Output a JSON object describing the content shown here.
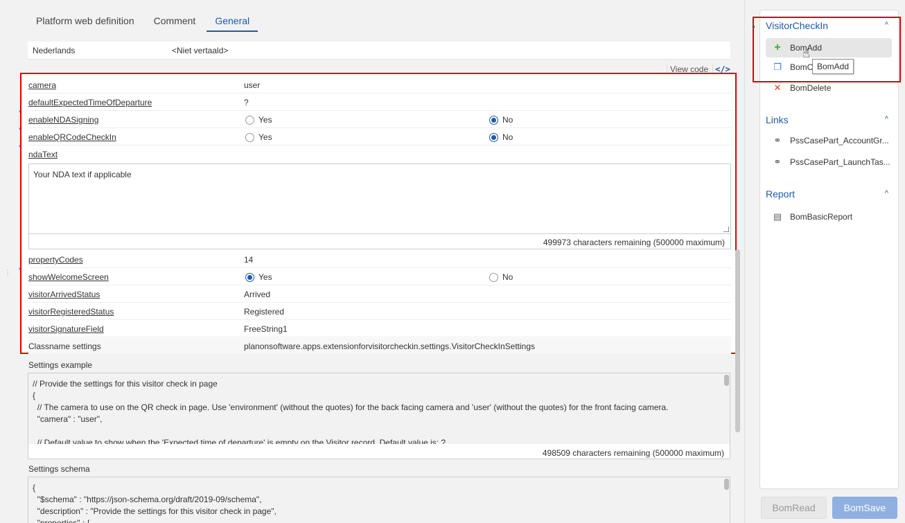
{
  "tabs": [
    {
      "label": "Platform web definition",
      "active": false
    },
    {
      "label": "Comment",
      "active": false
    },
    {
      "label": "General",
      "active": true
    }
  ],
  "language_row": {
    "key": "Nederlands",
    "value": "<Niet vertaald>"
  },
  "view_code": {
    "label": "View code",
    "icon": "code-icon"
  },
  "properties": {
    "camera": {
      "label": "camera",
      "value": "user"
    },
    "defaultExpectedTimeOfDeparture": {
      "label": "defaultExpectedTimeOfDeparture",
      "value": "?"
    },
    "enableNDASigning": {
      "label": "enableNDASigning",
      "yes": "Yes",
      "no": "No",
      "selected": "No"
    },
    "enableQRCodeCheckIn": {
      "label": "enableQRCodeCheckIn",
      "yes": "Yes",
      "no": "No",
      "selected": "No"
    },
    "ndaText": {
      "label": "ndaText",
      "value": "Your NDA text if applicable",
      "remaining": "499973 characters remaining (500000 maximum)"
    },
    "propertyCodes": {
      "label": "propertyCodes",
      "value": "14"
    },
    "showWelcomeScreen": {
      "label": "showWelcomeScreen",
      "yes": "Yes",
      "no": "No",
      "selected": "Yes"
    },
    "visitorArrivedStatus": {
      "label": "visitorArrivedStatus",
      "value": "Arrived"
    },
    "visitorRegisteredStatus": {
      "label": "visitorRegisteredStatus",
      "value": "Registered"
    },
    "visitorSignatureField": {
      "label": "visitorSignatureField",
      "value": "FreeString1"
    },
    "classname": {
      "label": "Classname settings",
      "value": "planonsoftware.apps.extensionforvisitorcheckin.settings.VisitorCheckInSettings"
    }
  },
  "settings_example": {
    "label": "Settings example",
    "code": "// Provide the settings for this visitor check in page\n{\n  // The camera to use on the QR check in page. Use 'environment' (without the quotes) for the back facing camera and 'user' (without the quotes) for the front facing camera.\n  \"camera\" : \"user\",\n\n  // Default value to show when the 'Expected time of departure' is empty on the Visitor record. Default value is: ?",
    "remaining": "498509 characters remaining (500000 maximum)"
  },
  "settings_schema": {
    "label": "Settings schema",
    "code": "{\n  \"$schema\" : \"https://json-schema.org/draft/2019-09/schema\",\n  \"description\" : \"Provide the settings for this visitor check in page\",\n  \"properties\" : {"
  },
  "side": {
    "section1": {
      "title": "VisitorCheckIn",
      "items": [
        {
          "label": "BomAdd",
          "icon": "plus-icon"
        },
        {
          "label": "BomC",
          "icon": "copy-icon"
        },
        {
          "label": "BomDelete",
          "icon": "close-icon"
        }
      ]
    },
    "tooltip": "BomAdd",
    "section2": {
      "title": "Links",
      "items": [
        {
          "label": "PssCasePart_AccountGr...",
          "icon": "link-icon"
        },
        {
          "label": "PssCasePart_LaunchTas...",
          "icon": "link-icon"
        }
      ]
    },
    "section3": {
      "title": "Report",
      "items": [
        {
          "label": "BomBasicReport",
          "icon": "document-icon"
        }
      ]
    }
  },
  "buttons": {
    "read": "BomRead",
    "save": "BomSave"
  },
  "colors": {
    "accent": "#1d5aa8",
    "highlight": "#e30000",
    "add": "#3aaa35",
    "delete": "#e23a2e"
  }
}
